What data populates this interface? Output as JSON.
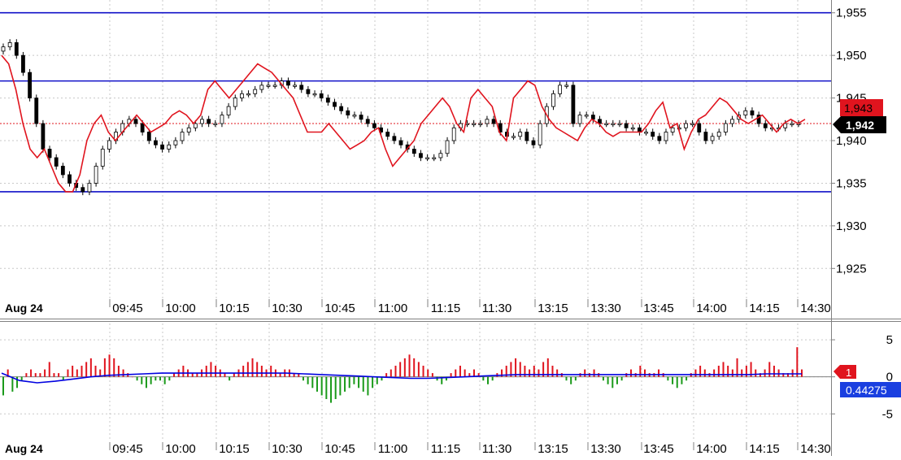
{
  "chart_data": [
    {
      "type": "candlestick",
      "title": "",
      "date_label": "Aug 24",
      "x_tick_labels": [
        "09:45",
        "10:00",
        "10:15",
        "10:30",
        "10:45",
        "11:00",
        "11:15",
        "11:30",
        "13:15",
        "13:30",
        "13:45",
        "14:00",
        "14:15",
        "14:30"
      ],
      "y_ticks": [
        "1,925",
        "1,930",
        "1,935",
        "1,940",
        "1,945",
        "1,950",
        "1,955"
      ],
      "y_tick_values": [
        1925,
        1930,
        1935,
        1940,
        1945,
        1950,
        1955
      ],
      "ylim": [
        1921.5,
        1956.5
      ],
      "grid": true,
      "horizontal_lines": [
        1955,
        1947,
        1934
      ],
      "current_price_line": 1942,
      "last_price_label": "1,942",
      "ma_price_label": "1,943",
      "price_series": {
        "name": "",
        "values": [
          1951,
          1951.5,
          1950,
          1948,
          1945,
          1942,
          1939,
          1938,
          1937,
          1936,
          1935,
          1934.5,
          1934,
          1935,
          1937,
          1939,
          1940,
          1941,
          1942,
          1942.5,
          1942,
          1941,
          1940,
          1939.5,
          1939,
          1939.5,
          1940,
          1941,
          1941.5,
          1942,
          1942.5,
          1942,
          1942,
          1943,
          1944,
          1945,
          1945.5,
          1945.5,
          1946,
          1946.5,
          1946.5,
          1946.5,
          1947,
          1946.5,
          1946.5,
          1946,
          1945.5,
          1945.5,
          1945,
          1944.5,
          1944,
          1943.5,
          1943,
          1943,
          1942.5,
          1942,
          1941.5,
          1941,
          1940.5,
          1940,
          1939.5,
          1939,
          1938.5,
          1938,
          1938,
          1938,
          1938.5,
          1940,
          1941.5,
          1942,
          1942,
          1942,
          1942,
          1942.5,
          1942,
          1941,
          1940.5,
          1940.5,
          1941,
          1940,
          1939.5,
          1942,
          1944,
          1945.5,
          1946.5,
          1946.5,
          1942,
          1943,
          1943,
          1942.5,
          1942,
          1942,
          1942,
          1942,
          1941.5,
          1941.5,
          1941,
          1941,
          1940.5,
          1940,
          1941,
          1941.5,
          1941.5,
          1942,
          1942,
          1941,
          1940,
          1940.5,
          1941,
          1942,
          1942.5,
          1943,
          1943.5,
          1943,
          1942,
          1941.5,
          1941.5,
          1941.5,
          1942,
          1942,
          1942
        ]
      },
      "red_line_series": {
        "name": "",
        "values": [
          1950,
          1949,
          1946,
          1942,
          1939,
          1938,
          1939,
          1937,
          1935,
          1934,
          1934,
          1936,
          1940,
          1942,
          1943,
          1941,
          1940,
          1941,
          1942,
          1943,
          1942,
          1941,
          1941.5,
          1942,
          1943,
          1943.5,
          1943,
          1942,
          1943,
          1946,
          1947,
          1946,
          1945,
          1946,
          1947,
          1948,
          1949,
          1948.5,
          1948,
          1947,
          1946,
          1945,
          1943,
          1941,
          1941,
          1941,
          1942,
          1941,
          1940,
          1939,
          1939.5,
          1940,
          1941,
          1941.5,
          1939,
          1937,
          1938,
          1939,
          1940,
          1942,
          1943,
          1944,
          1945,
          1944,
          1942,
          1941,
          1945,
          1946,
          1945,
          1944,
          1941,
          1940,
          1945,
          1946,
          1947,
          1946.5,
          1944,
          1942.5,
          1941.5,
          1941,
          1940.5,
          1940,
          1941.5,
          1942.5,
          1942,
          1941,
          1940.5,
          1941,
          1941,
          1941,
          1941,
          1942,
          1943.5,
          1944.5,
          1941.5,
          1942,
          1939,
          1941,
          1942.5,
          1943,
          1944,
          1945,
          1944.5,
          1943.5,
          1942.5,
          1942,
          1942.5,
          1943,
          1942,
          1941,
          1942,
          1942.5,
          1942,
          1942.5
        ]
      }
    },
    {
      "type": "bar",
      "title": "",
      "date_label": "Aug 24",
      "x_tick_labels": [
        "09:45",
        "10:00",
        "10:15",
        "10:30",
        "10:45",
        "11:00",
        "11:15",
        "11:30",
        "13:15",
        "13:30",
        "13:45",
        "14:00",
        "14:15",
        "14:30"
      ],
      "y_ticks": [
        "5",
        "0",
        "-5"
      ],
      "y_tick_values": [
        5,
        0,
        -5
      ],
      "ylim": [
        -8.7,
        7.2
      ],
      "grid": true,
      "last_value_label": "1",
      "ma_value_label": "0.44275",
      "histogram": {
        "name": "",
        "values": [
          -2.5,
          1,
          -2,
          -1.5,
          -0.5,
          0.5,
          1,
          0.5,
          0.5,
          1,
          2,
          0.5,
          0.5,
          -0.5,
          1,
          1.5,
          1,
          1.5,
          2,
          2.5,
          1.5,
          1,
          2.5,
          3,
          2.5,
          1.5,
          1,
          0.5,
          0,
          -0.5,
          -1,
          -1.5,
          -1,
          -0.5,
          -0.5,
          -1,
          -0.5,
          0.5,
          1,
          1.5,
          1,
          0.5,
          0.5,
          1,
          1.5,
          2,
          1.5,
          1,
          0.5,
          -0.5,
          0.5,
          1,
          1.5,
          2,
          2.5,
          2,
          1.5,
          1,
          1.5,
          1,
          0.5,
          1,
          1,
          0.5,
          0.5,
          -0.5,
          -1,
          -1.5,
          -2,
          -2.5,
          -3,
          -3.5,
          -3,
          -2.5,
          -2,
          -1.5,
          -1,
          -1.5,
          -2,
          -2.5,
          -1.5,
          -1,
          -0.5,
          0.5,
          1,
          1.5,
          2,
          2.5,
          3,
          2.5,
          2,
          1.5,
          1,
          0.5,
          -0.5,
          -1,
          -0.5,
          0.5,
          1,
          1.5,
          1,
          0.5,
          1,
          0.5,
          -0.5,
          -1,
          -0.5,
          0.5,
          1,
          1.5,
          2,
          2.5,
          2,
          1.5,
          1,
          1.5,
          1,
          2,
          2.5,
          1.5,
          1,
          0.5,
          -0.5,
          -1,
          -0.5,
          0.5,
          1,
          0.5,
          1,
          0.5,
          -0.5,
          -1,
          -1.5,
          -1,
          -0.5,
          0.5,
          1,
          0.5,
          1.5,
          1,
          0.5,
          0.5,
          1,
          0.5,
          -0.5,
          -1,
          -1.5,
          -1,
          -0.5,
          0.5,
          1,
          1.5,
          1,
          0.5,
          1,
          1.5,
          2,
          1.5,
          1,
          2.5,
          1,
          1.5,
          2,
          1,
          0.5,
          1,
          2,
          1.5,
          1,
          0.5,
          0.5,
          1,
          4,
          1
        ]
      },
      "blue_line_series": {
        "name": "",
        "values": [
          0.5,
          -0.5,
          -0.8,
          -0.6,
          -0.3,
          0,
          0.2,
          0.3,
          0.4,
          0.5,
          0.5,
          0.5,
          0.5,
          0.5,
          0.5,
          0.5,
          0.5,
          0.4,
          0.3,
          0.2,
          0.1,
          0,
          -0.1,
          -0.2,
          -0.2,
          -0.1,
          0,
          0.1,
          0.2,
          0.3,
          0.3,
          0.3,
          0.3,
          0.3,
          0.3,
          0.3,
          0.3,
          0.3,
          0.3,
          0.3,
          0.3,
          0.3,
          0.3,
          0.4,
          0.4,
          0.4
        ]
      }
    }
  ]
}
